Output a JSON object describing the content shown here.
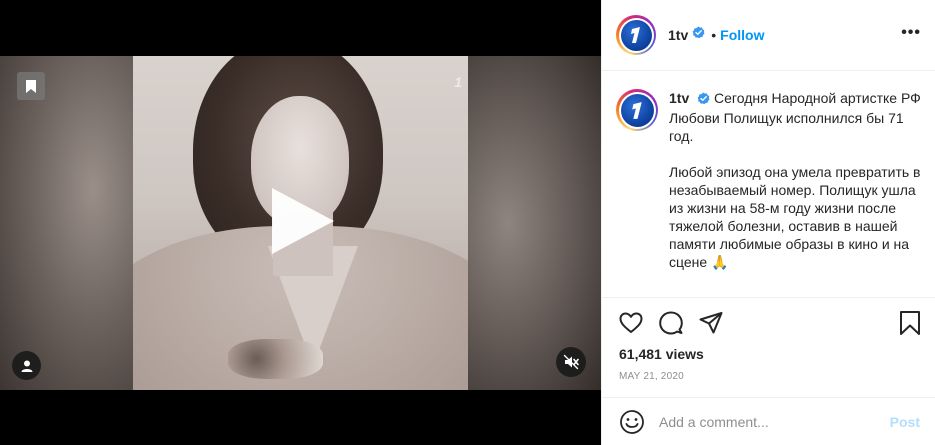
{
  "post": {
    "username": "1tv",
    "follow_label": "Follow",
    "dot": "•",
    "more_label": "•••",
    "video_watermark": "1",
    "caption_line1": "Сегодня Народной артистке РФ Любови Полищук исполнился бы 71 год.",
    "caption_line2": "Любой эпизод она умела превратить в незабываемый номер. Полищук ушла из жизни на 58-м году жизни после тяжелой болезни, оставив в нашей памяти любимые образы в кино и на сцене 🙏",
    "views": "61,481 views",
    "date": "MAY 21, 2020",
    "comment_placeholder": "Add a comment...",
    "post_label": "Post"
  },
  "icons": {
    "verified": "verified-badge-icon",
    "like": "heart-icon",
    "comment": "comment-icon",
    "share": "paper-plane-icon",
    "save": "bookmark-icon",
    "emoji": "emoji-smile-icon",
    "play": "play-icon",
    "mute": "muted-speaker-icon",
    "user": "user-tag-icon"
  },
  "colors": {
    "accent": "#0095f6",
    "post_disabled": "#b2dffc",
    "muted_text": "#8e8e8e",
    "text": "#262626",
    "logo_blue": "#0b3f9c"
  }
}
